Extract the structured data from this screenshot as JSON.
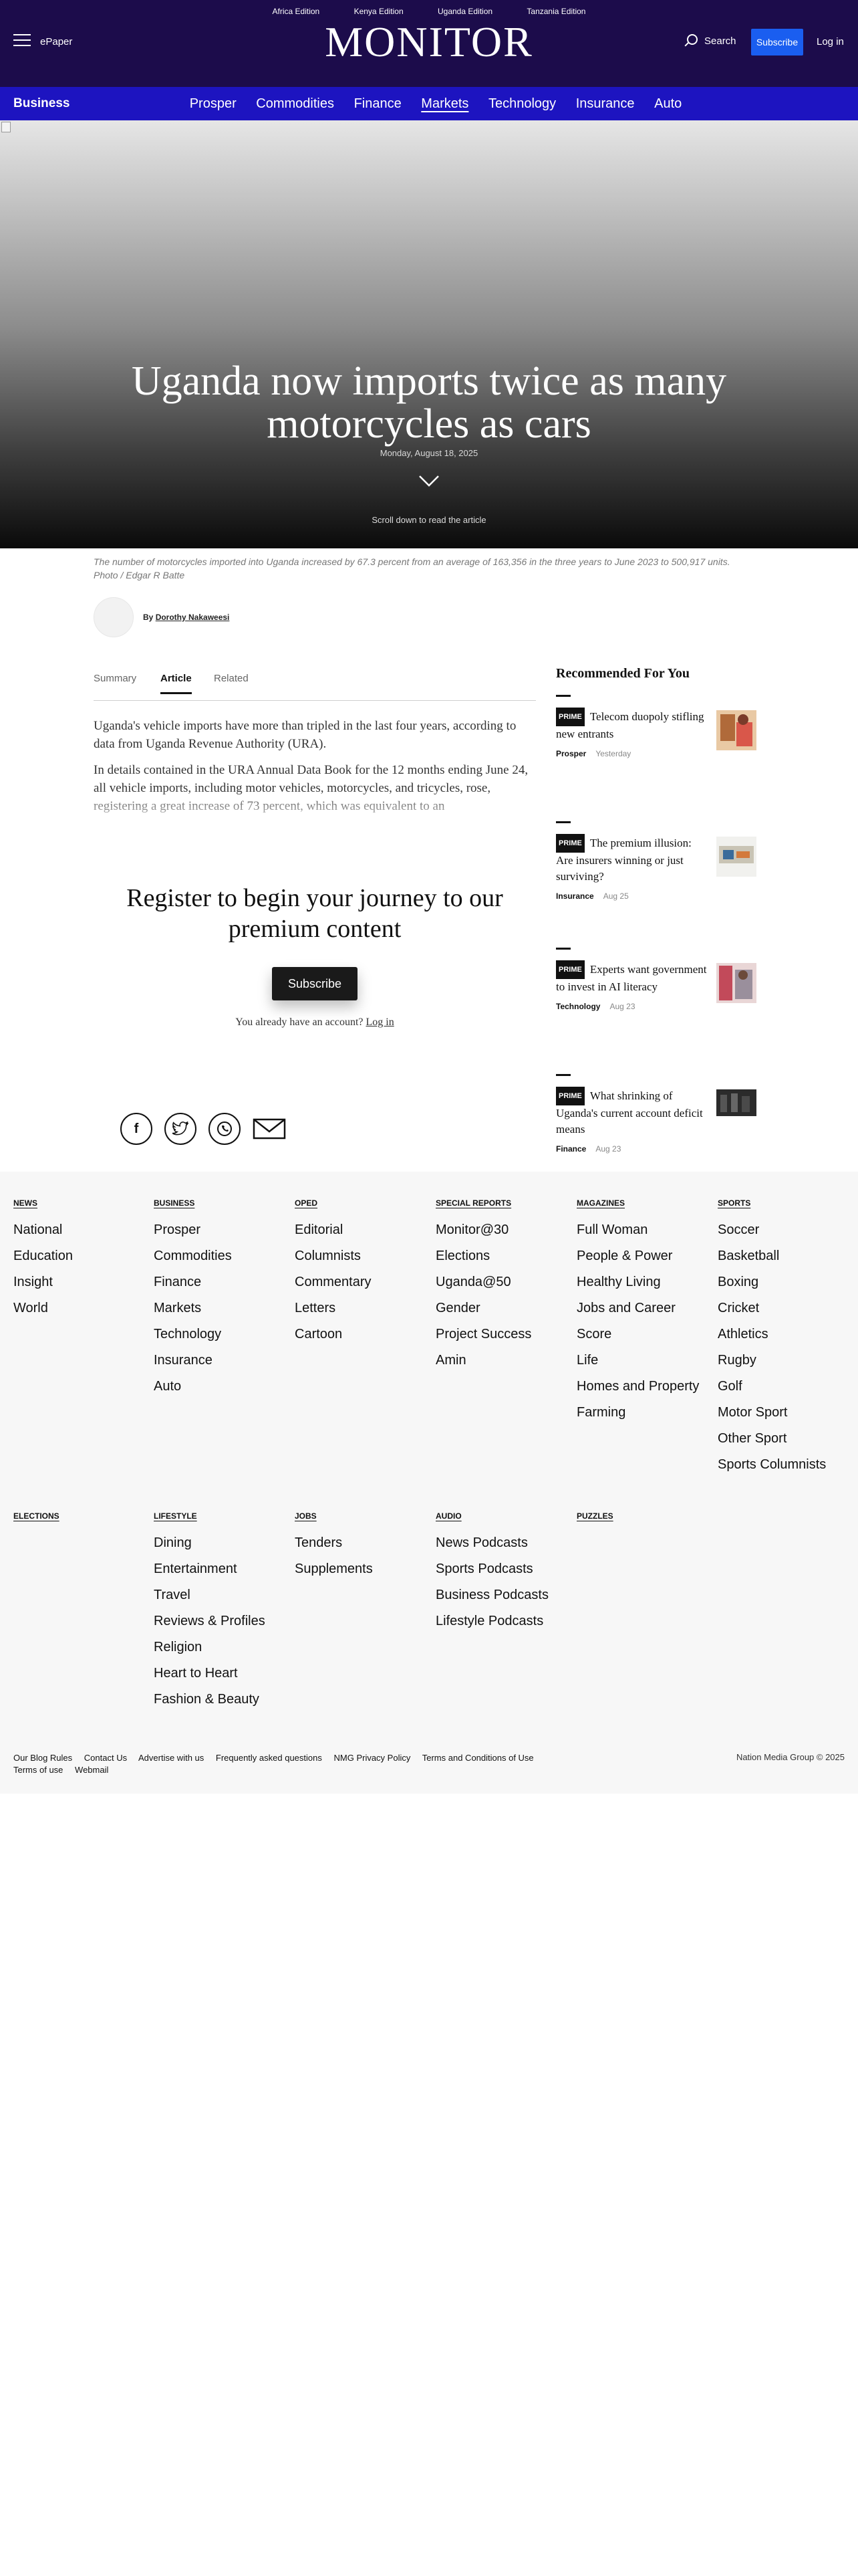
{
  "header": {
    "editions": [
      "Africa Edition",
      "Kenya Edition",
      "Uganda Edition",
      "Tanzania Edition"
    ],
    "epaper": "ePaper",
    "logo": "MONITOR",
    "search": "Search",
    "subscribe": "Subscribe",
    "login": "Log in"
  },
  "nav": {
    "section": "Business",
    "links": [
      "Prosper",
      "Commodities",
      "Finance",
      "Markets",
      "Technology",
      "Insurance",
      "Auto"
    ],
    "active": "Markets"
  },
  "hero": {
    "title": "Uganda now imports twice as many motorcycles as cars",
    "date": "Monday, August 18, 2025",
    "scroll_hint": "Scroll down to read the article"
  },
  "caption": "The number of motorcycles imported into Uganda increased by 67.3 percent from an average of 163,356 in the three years to June 2023 to 500,917 units. Photo / Edgar R Batte",
  "author": {
    "prefix": "By",
    "name": "Dorothy Nakaweesi"
  },
  "tabs": [
    "Summary",
    "Article",
    "Related"
  ],
  "article": {
    "p1": "Uganda's vehicle imports have more than tripled in the last four years, according to data from Uganda Revenue Authority (URA).",
    "p2": "In details contained in the URA Annual Data Book for the 12 months ending June 24, all vehicle imports, including motor vehicles, motorcycles, and tricycles, rose, registering a great increase of 73 percent, which was equivalent to an"
  },
  "paywall": {
    "title": "Register to begin your journey to our premium content",
    "button": "Subscribe",
    "login_prompt": "You already have an account?",
    "login_link": "Log in"
  },
  "share": {
    "facebook": "f",
    "twitter": "t",
    "whatsapp": "w"
  },
  "recommended": {
    "title": "Recommended For You",
    "items": [
      {
        "badge": "PRIME",
        "title": "Telecom duopoly stifling new entrants",
        "section": "Prosper",
        "date": "Yesterday"
      },
      {
        "badge": "",
        "title": "The premium illusion: Are insurers winning or just surviving?",
        "section": "Insurance",
        "date": "Aug 25"
      },
      {
        "badge": "PRIME",
        "title": "Experts want government to invest in AI literacy",
        "section": "Technology",
        "date": "Aug 23"
      },
      {
        "badge": "PRIME",
        "title": "What shrinking of Uganda's current account deficit means",
        "section": "Finance",
        "date": "Aug 23"
      }
    ]
  },
  "footer": {
    "columns": [
      {
        "head": "NEWS",
        "links": [
          "National",
          "Education",
          "Insight",
          "World"
        ]
      },
      {
        "head": "BUSINESS",
        "links": [
          "Prosper",
          "Commodities",
          "Finance",
          "Markets",
          "Technology",
          "Insurance",
          "Auto"
        ]
      },
      {
        "head": "OPED",
        "links": [
          "Editorial",
          "Columnists",
          "Commentary",
          "Letters",
          "Cartoon"
        ]
      },
      {
        "head": "SPECIAL REPORTS",
        "links": [
          "Monitor@30",
          "Elections",
          "Uganda@50",
          "Gender",
          "Project Success",
          "Amin"
        ]
      },
      {
        "head": "MAGAZINES",
        "links": [
          "Full Woman",
          "People & Power",
          "Healthy Living",
          "Jobs and Career",
          "Score",
          "Life",
          "Homes and Property",
          "Farming"
        ]
      },
      {
        "head": "SPORTS",
        "links": [
          "Soccer",
          "Basketball",
          "Boxing",
          "Cricket",
          "Athletics",
          "Rugby",
          "Golf",
          "Motor Sport",
          "Other Sport",
          "Sports Columnists"
        ]
      },
      {
        "head": "ELECTIONS",
        "links": []
      },
      {
        "head": "LIFESTYLE",
        "links": [
          "Dining",
          "Entertainment",
          "Travel",
          "Reviews & Profiles",
          "Religion",
          "Heart to Heart",
          "Fashion & Beauty"
        ]
      },
      {
        "head": "JOBS",
        "links": [
          "Tenders",
          "Supplements"
        ]
      },
      {
        "head": "AUDIO",
        "links": [
          "News Podcasts",
          "Sports Podcasts",
          "Business Podcasts",
          "Lifestyle Podcasts"
        ]
      },
      {
        "head": "PUZZLES",
        "links": []
      }
    ],
    "bottom_links": [
      "Our Blog Rules",
      "Contact Us",
      "Advertise with us",
      "Frequently asked questions",
      "NMG Privacy Policy",
      "Terms and Conditions of Use",
      "Terms of use",
      "Webmail"
    ],
    "copyright": "Nation Media Group © 2025"
  },
  "colors": {
    "header_bg": "#1c0c4b",
    "nav_bg": "#1d14c0",
    "subscribe_bg": "#1a5ef0",
    "footer_bg": "#f7f7f7"
  },
  "icons": [
    "hamburger-icon",
    "search-icon",
    "chevron-down-icon",
    "facebook-icon",
    "twitter-icon",
    "whatsapp-icon",
    "email-icon"
  ]
}
